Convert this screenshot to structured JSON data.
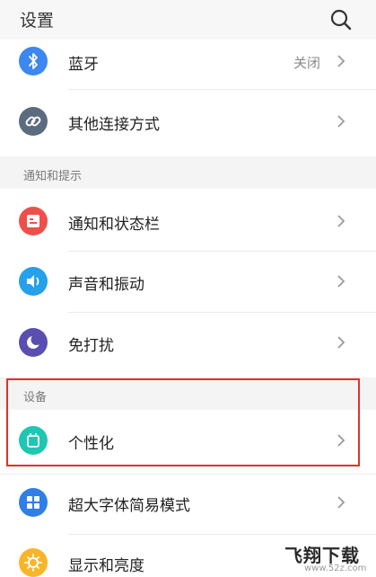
{
  "header": {
    "title": "设置"
  },
  "rows": {
    "bluetooth": {
      "label": "蓝牙",
      "value": "关闭",
      "icon": "bluetooth-icon",
      "color": "#3c87f0"
    },
    "other_connections": {
      "label": "其他连接方式",
      "icon": "link-icon",
      "color": "#5b6c7e"
    },
    "notifications": {
      "label": "通知和状态栏",
      "icon": "notification-icon",
      "color": "#ef4f4a"
    },
    "sound": {
      "label": "声音和振动",
      "icon": "speaker-icon",
      "color": "#26a0e8"
    },
    "dnd": {
      "label": "免打扰",
      "icon": "moon-icon",
      "color": "#5a4fb0"
    },
    "personalization": {
      "label": "个性化",
      "icon": "theme-icon",
      "color": "#1fc7b2"
    },
    "large_font": {
      "label": "超大字体简易模式",
      "icon": "grid-icon",
      "color": "#2f7fe6"
    },
    "display": {
      "label": "显示和亮度",
      "icon": "sun-icon",
      "color": "#f8b52a"
    }
  },
  "sections": {
    "notify": "通知和提示",
    "device": "设备"
  },
  "watermark": {
    "text": "飞翔下载",
    "url": "www.52z.com"
  },
  "highlight_color": "#e0312c"
}
